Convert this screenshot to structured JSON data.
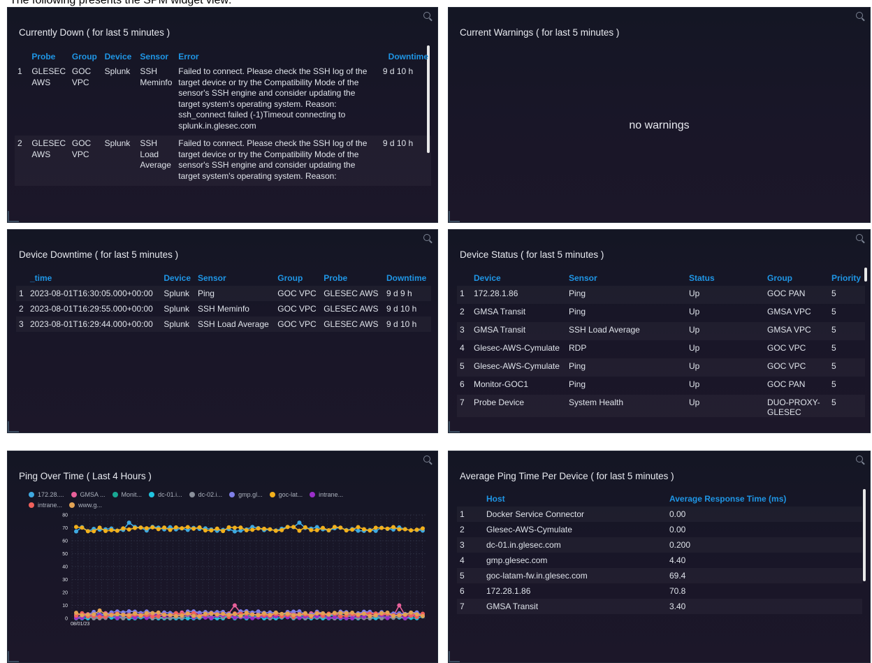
{
  "caption": "The following presents the SPM widget view:",
  "panels": {
    "down": {
      "title": "Currently Down ( for last 5 minutes )",
      "headers": [
        "Probe",
        "Group",
        "Device",
        "Sensor",
        "Error",
        "Downtime"
      ],
      "rows": [
        {
          "n": "1",
          "probe": "GLESEC AWS",
          "group": "GOC VPC",
          "device": "Splunk",
          "sensor": "SSH Meminfo",
          "error": "Failed to connect. Please check the SSH log of the target device or try the Compatibility Mode of the sensor's SSH engine and consider updating the target system's operating system. Reason: ssh_connect failed (-1)Timeout connecting to splunk.in.glesec.com",
          "downtime": "9 d 10 h"
        },
        {
          "n": "2",
          "probe": "GLESEC AWS",
          "group": "GOC VPC",
          "device": "Splunk",
          "sensor": "SSH Load Average",
          "error": "Failed to connect. Please check the SSH log of the target device or try the Compatibility Mode of the sensor's SSH engine and consider updating the target system's operating system. Reason:",
          "downtime": "9 d 10 h"
        }
      ]
    },
    "warnings": {
      "title": "Current Warnings ( for last 5 minutes )",
      "empty": "no warnings"
    },
    "downtime": {
      "title": "Device Downtime ( for last 5 minutes )",
      "headers": [
        "_time",
        "Device",
        "Sensor",
        "Group",
        "Probe",
        "Downtime"
      ],
      "rows": [
        {
          "n": "1",
          "time": "2023-08-01T16:30:05.000+00:00",
          "device": "Splunk",
          "sensor": "Ping",
          "group": "GOC VPC",
          "probe": "GLESEC AWS",
          "downtime": "9 d 9 h"
        },
        {
          "n": "2",
          "time": "2023-08-01T16:29:55.000+00:00",
          "device": "Splunk",
          "sensor": "SSH Meminfo",
          "group": "GOC VPC",
          "probe": "GLESEC AWS",
          "downtime": "9 d 10 h"
        },
        {
          "n": "3",
          "time": "2023-08-01T16:29:44.000+00:00",
          "device": "Splunk",
          "sensor": "SSH Load Average",
          "group": "GOC VPC",
          "probe": "GLESEC AWS",
          "downtime": "9 d 10 h"
        }
      ]
    },
    "status": {
      "title": "Device Status ( for last 5 minutes )",
      "headers": [
        "Device",
        "Sensor",
        "Status",
        "Group",
        "Priority"
      ],
      "rows": [
        {
          "n": "1",
          "device": "172.28.1.86",
          "sensor": "Ping",
          "status": "Up",
          "group": "GOC PAN",
          "priority": "5"
        },
        {
          "n": "2",
          "device": "GMSA Transit",
          "sensor": "Ping",
          "status": "Up",
          "group": "GMSA VPC",
          "priority": "5"
        },
        {
          "n": "3",
          "device": "GMSA Transit",
          "sensor": "SSH Load Average",
          "status": "Up",
          "group": "GMSA VPC",
          "priority": "5"
        },
        {
          "n": "4",
          "device": "Glesec-AWS-Cymulate",
          "sensor": "RDP",
          "status": "Up",
          "group": "GOC VPC",
          "priority": "5"
        },
        {
          "n": "5",
          "device": "Glesec-AWS-Cymulate",
          "sensor": "Ping",
          "status": "Up",
          "group": "GOC VPC",
          "priority": "5"
        },
        {
          "n": "6",
          "device": "Monitor-GOC1",
          "sensor": "Ping",
          "status": "Up",
          "group": "GOC PAN",
          "priority": "5"
        },
        {
          "n": "7",
          "device": "Probe Device",
          "sensor": "System Health",
          "status": "Up",
          "group": "DUO-PROXY-GLESEC",
          "priority": "5"
        }
      ]
    },
    "ping": {
      "title": "Ping Over Time ( Last 4 Hours )"
    },
    "avg": {
      "title": "Average Ping Time Per Device ( for last 5 minutes )",
      "headers": [
        "Host",
        "Average Response Time (ms)"
      ],
      "rows": [
        {
          "n": "1",
          "host": "Docker Service Connector",
          "value": "0.00"
        },
        {
          "n": "2",
          "host": "Glesec-AWS-Cymulate",
          "value": "0.00"
        },
        {
          "n": "3",
          "host": "dc-01.in.glesec.com",
          "value": "0.200"
        },
        {
          "n": "4",
          "host": "gmp.glesec.com",
          "value": "4.40"
        },
        {
          "n": "5",
          "host": "goc-latam-fw.in.glesec.com",
          "value": "69.4"
        },
        {
          "n": "6",
          "host": "172.28.1.86",
          "value": "70.8"
        },
        {
          "n": "7",
          "host": "GMSA Transit",
          "value": "3.40"
        }
      ]
    }
  },
  "chart_data": {
    "type": "line",
    "title": "Ping Over Time ( Last 4 Hours )",
    "xlabel": "",
    "ylabel": "",
    "ylim": [
      0,
      80
    ],
    "yticks": [
      "80",
      "70",
      "60",
      "50",
      "40",
      "30",
      "20",
      "10",
      "0"
    ],
    "x_tick_label": "08/01/23",
    "grid": true,
    "legend_position": "top",
    "series": [
      {
        "name": "172.28....",
        "color": "#3fa9e0",
        "level": 69
      },
      {
        "name": "GMSA ...",
        "color": "#e8609a",
        "level": 3
      },
      {
        "name": "Monit...",
        "color": "#19a894",
        "level": 2
      },
      {
        "name": "dc-01.i...",
        "color": "#21c4e0",
        "level": 0
      },
      {
        "name": "dc-02.i...",
        "color": "#8a8f9a",
        "level": 1
      },
      {
        "name": "gmp.gl...",
        "color": "#7f7fe8",
        "level": 4
      },
      {
        "name": "goc-lat...",
        "color": "#f2b01c",
        "level": 69
      },
      {
        "name": "intrane...",
        "color": "#9b2fc9",
        "level": 1.5
      },
      {
        "name": "intrane...",
        "color": "#f0615c",
        "level": 2.5
      },
      {
        "name": "www.g...",
        "color": "#e3a455",
        "level": 3
      }
    ]
  }
}
